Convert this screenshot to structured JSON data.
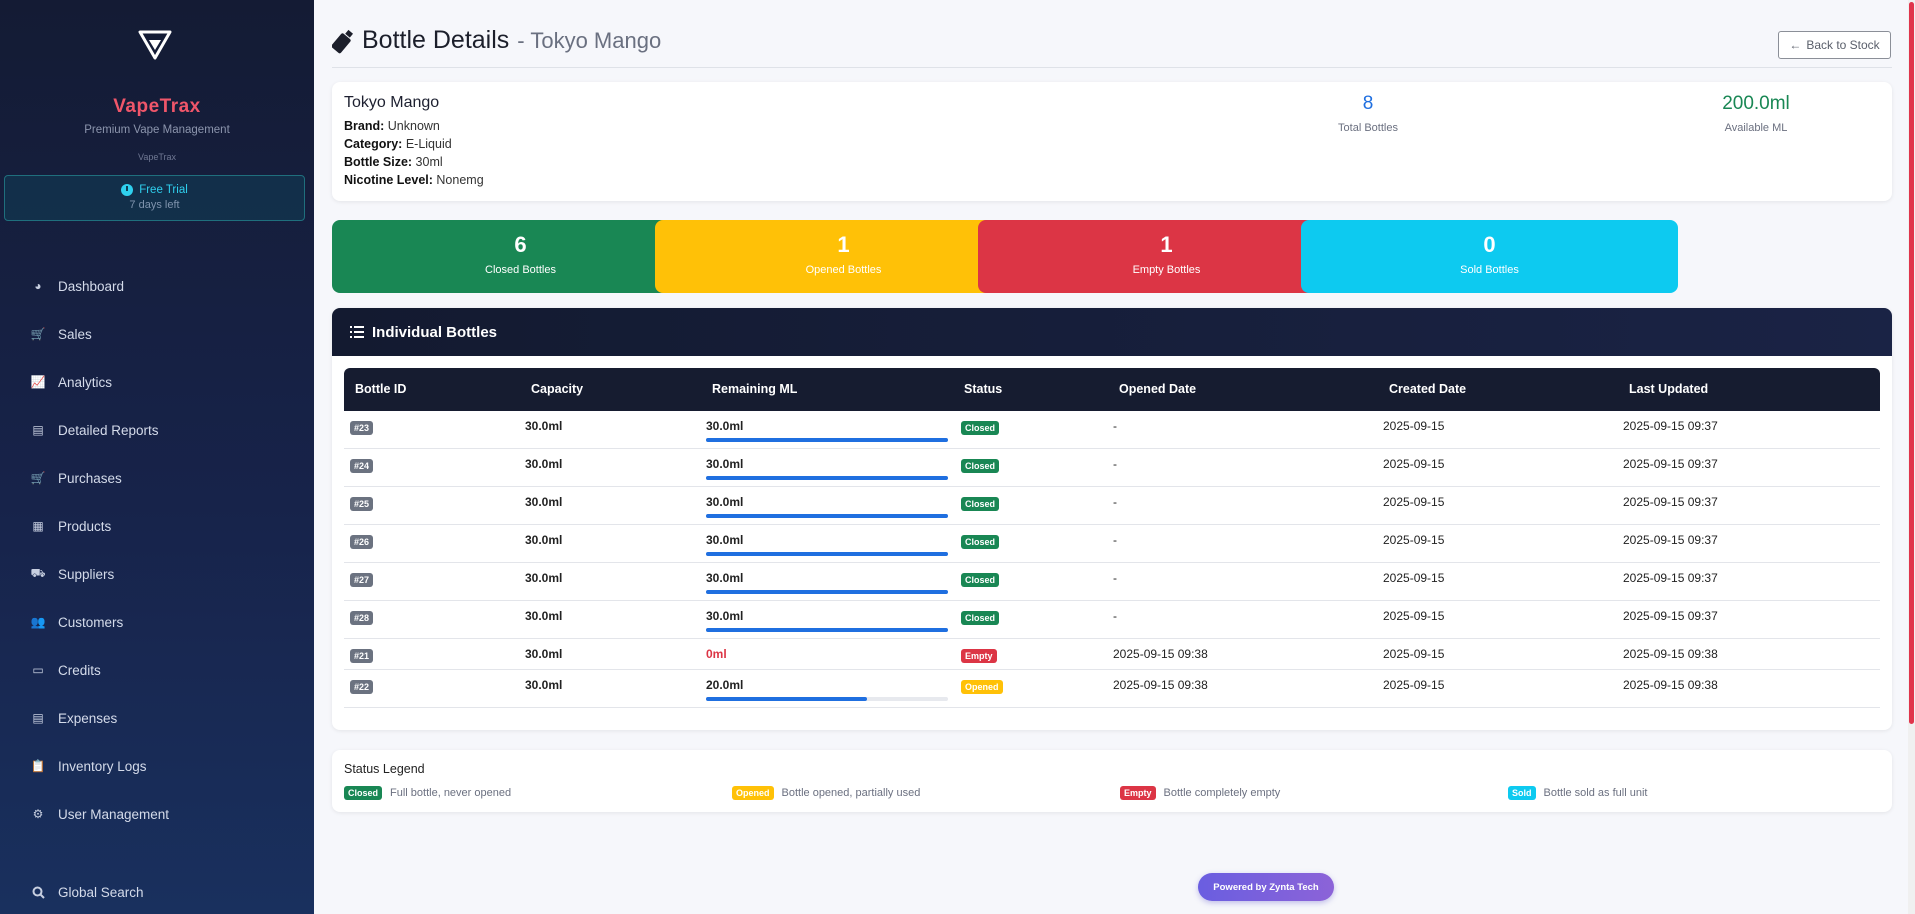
{
  "sidebar": {
    "brand": "VapeTrax",
    "tagline": "Premium Vape Management",
    "sub": "VapeTrax",
    "trial_title": "Free Trial",
    "trial_days": "7 days left",
    "items": [
      {
        "label": "Dashboard",
        "icon": "palette-icon"
      },
      {
        "label": "Sales",
        "icon": "cart-icon"
      },
      {
        "label": "Analytics",
        "icon": "line-chart-icon"
      },
      {
        "label": "Detailed Reports",
        "icon": "document-icon"
      },
      {
        "label": "Purchases",
        "icon": "cart-icon"
      },
      {
        "label": "Products",
        "icon": "boxes-icon"
      },
      {
        "label": "Suppliers",
        "icon": "truck-icon"
      },
      {
        "label": "Customers",
        "icon": "users-icon"
      },
      {
        "label": "Credits",
        "icon": "credit-card-icon"
      },
      {
        "label": "Expenses",
        "icon": "receipt-icon"
      },
      {
        "label": "Inventory Logs",
        "icon": "clipboard-icon"
      },
      {
        "label": "User Management",
        "icon": "user-cog-icon"
      }
    ],
    "global_search": "Global Search"
  },
  "header": {
    "title": "Bottle Details",
    "subtitle": "- Tokyo Mango",
    "back_label": "Back to Stock"
  },
  "product": {
    "name": "Tokyo Mango",
    "brand_label": "Brand:",
    "brand": "Unknown",
    "category_label": "Category:",
    "category": "E-Liquid",
    "size_label": "Bottle Size:",
    "size": "30ml",
    "nicotine_label": "Nicotine Level:",
    "nicotine": "Nonemg",
    "total_bottles": "8",
    "total_bottles_label": "Total Bottles",
    "available_ml": "200.0ml",
    "available_ml_label": "Available ML"
  },
  "counts": [
    {
      "value": "6",
      "label": "Closed Bottles",
      "color": "#198754"
    },
    {
      "value": "1",
      "label": "Opened Bottles",
      "color": "#ffc107"
    },
    {
      "value": "1",
      "label": "Empty Bottles",
      "color": "#dc3545"
    },
    {
      "value": "0",
      "label": "Sold Bottles",
      "color": "#0dcaf0"
    }
  ],
  "bottles": {
    "title": "Individual Bottles",
    "columns": [
      "Bottle ID",
      "Capacity",
      "Remaining ML",
      "Status",
      "Opened Date",
      "Created Date",
      "Last Updated"
    ],
    "rows": [
      {
        "id": "#23",
        "capacity": "30.0ml",
        "remaining": "30.0ml",
        "fill": 1.0,
        "status": "Closed",
        "opened": "-",
        "created": "2025-09-15",
        "updated": "2025-09-15 09:37"
      },
      {
        "id": "#24",
        "capacity": "30.0ml",
        "remaining": "30.0ml",
        "fill": 1.0,
        "status": "Closed",
        "opened": "-",
        "created": "2025-09-15",
        "updated": "2025-09-15 09:37"
      },
      {
        "id": "#25",
        "capacity": "30.0ml",
        "remaining": "30.0ml",
        "fill": 1.0,
        "status": "Closed",
        "opened": "-",
        "created": "2025-09-15",
        "updated": "2025-09-15 09:37"
      },
      {
        "id": "#26",
        "capacity": "30.0ml",
        "remaining": "30.0ml",
        "fill": 1.0,
        "status": "Closed",
        "opened": "-",
        "created": "2025-09-15",
        "updated": "2025-09-15 09:37"
      },
      {
        "id": "#27",
        "capacity": "30.0ml",
        "remaining": "30.0ml",
        "fill": 1.0,
        "status": "Closed",
        "opened": "-",
        "created": "2025-09-15",
        "updated": "2025-09-15 09:37"
      },
      {
        "id": "#28",
        "capacity": "30.0ml",
        "remaining": "30.0ml",
        "fill": 1.0,
        "status": "Closed",
        "opened": "-",
        "created": "2025-09-15",
        "updated": "2025-09-15 09:37"
      },
      {
        "id": "#21",
        "capacity": "30.0ml",
        "remaining": "0ml",
        "fill": 0,
        "status": "Empty",
        "opened": "2025-09-15 09:38",
        "created": "2025-09-15",
        "updated": "2025-09-15 09:38"
      },
      {
        "id": "#22",
        "capacity": "30.0ml",
        "remaining": "20.0ml",
        "fill": 0.667,
        "status": "Opened",
        "opened": "2025-09-15 09:38",
        "created": "2025-09-15",
        "updated": "2025-09-15 09:38"
      }
    ]
  },
  "status_colors": {
    "Closed": "#198754",
    "Opened": "#ffc107",
    "Empty": "#dc3545",
    "Sold": "#0dcaf0"
  },
  "legend": {
    "title": "Status Legend",
    "items": [
      {
        "status": "Closed",
        "desc": "Full bottle, never opened"
      },
      {
        "status": "Opened",
        "desc": "Bottle opened, partially used"
      },
      {
        "status": "Empty",
        "desc": "Bottle completely empty"
      },
      {
        "status": "Sold",
        "desc": "Bottle sold as full unit"
      }
    ]
  },
  "footer": {
    "powered": "Powered by Zynta Tech"
  }
}
